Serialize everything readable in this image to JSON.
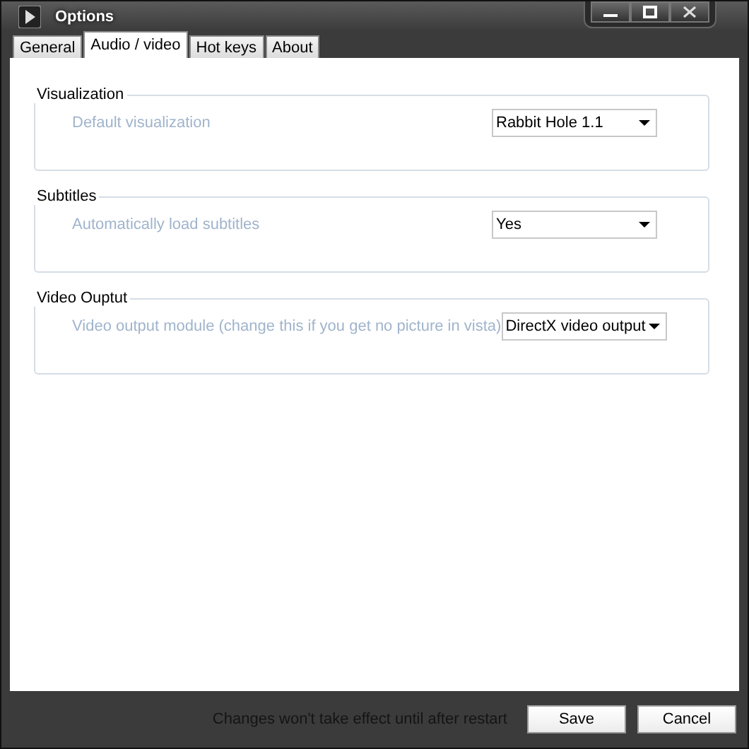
{
  "window": {
    "title": "Options"
  },
  "tabs": [
    {
      "label": "General",
      "selected": false
    },
    {
      "label": "Audio / video",
      "selected": true
    },
    {
      "label": "Hot keys",
      "selected": false
    },
    {
      "label": "About",
      "selected": false
    }
  ],
  "groups": [
    {
      "title": "Visualization",
      "setting": {
        "label": "Default visualization",
        "value": "Rabbit Hole 1.1"
      }
    },
    {
      "title": "Subtitles",
      "setting": {
        "label": "Automatically load subtitles",
        "value": "Yes"
      }
    },
    {
      "title": "Video Ouptut",
      "setting": {
        "label": "Video output module (change this if you get no picture in vista)",
        "value": "DirectX video output"
      }
    }
  ],
  "footer": {
    "note": "Changes won't take effect until after restart",
    "buttons": [
      "Save",
      "Cancel"
    ]
  }
}
